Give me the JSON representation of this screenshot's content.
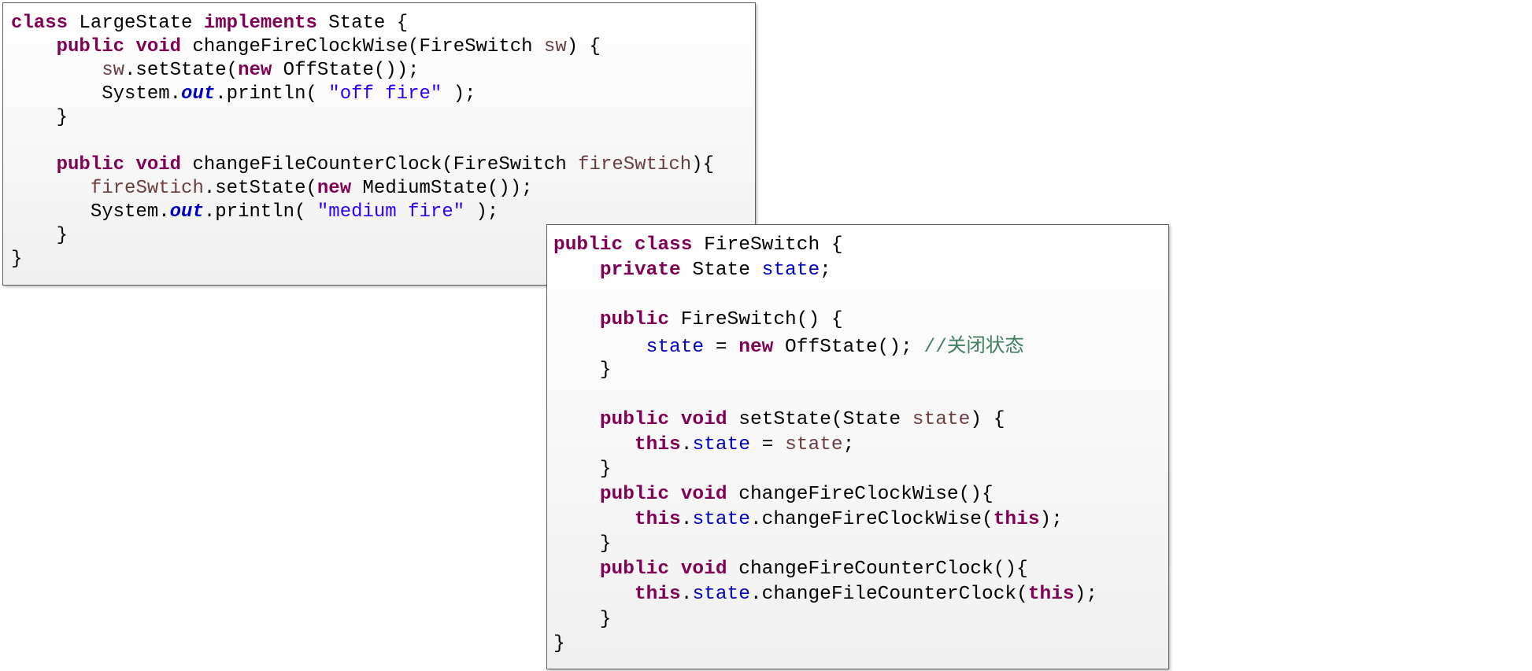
{
  "colors": {
    "keyword": "#7f0055",
    "plain": "#000000",
    "parameter": "#6a3e3e",
    "field": "#0000c0",
    "string": "#2a00ff",
    "comment": "#3f7f5f",
    "border": "#5f5f5f"
  },
  "snippets": [
    {
      "id": "large-state",
      "lines": [
        [
          [
            "kw",
            "class"
          ],
          [
            "plain",
            " LargeState "
          ],
          [
            "kw",
            "implements"
          ],
          [
            "plain",
            " State {"
          ]
        ],
        [
          [
            "plain",
            "    "
          ],
          [
            "kw",
            "public"
          ],
          [
            "plain",
            " "
          ],
          [
            "kw",
            "void"
          ],
          [
            "plain",
            " changeFireClockWise(FireSwitch "
          ],
          [
            "param",
            "sw"
          ],
          [
            "plain",
            ") {"
          ]
        ],
        [
          [
            "plain",
            "        "
          ],
          [
            "param",
            "sw"
          ],
          [
            "plain",
            ".setState("
          ],
          [
            "kw",
            "new"
          ],
          [
            "plain",
            " OffState());"
          ]
        ],
        [
          [
            "plain",
            "        System."
          ],
          [
            "static",
            "out"
          ],
          [
            "plain",
            ".println( "
          ],
          [
            "str",
            "\"off fire\""
          ],
          [
            "plain",
            " );"
          ]
        ],
        [
          [
            "plain",
            "    }"
          ]
        ],
        [
          [
            "plain",
            ""
          ]
        ],
        [
          [
            "plain",
            "    "
          ],
          [
            "kw",
            "public"
          ],
          [
            "plain",
            " "
          ],
          [
            "kw",
            "void"
          ],
          [
            "plain",
            " changeFileCounterClock(FireSwitch "
          ],
          [
            "param",
            "fireSwtich"
          ],
          [
            "plain",
            "){"
          ]
        ],
        [
          [
            "plain",
            "       "
          ],
          [
            "param",
            "fireSwtich"
          ],
          [
            "plain",
            ".setState("
          ],
          [
            "kw",
            "new"
          ],
          [
            "plain",
            " MediumState());"
          ]
        ],
        [
          [
            "plain",
            "       System."
          ],
          [
            "static",
            "out"
          ],
          [
            "plain",
            ".println( "
          ],
          [
            "str",
            "\"medium fire\""
          ],
          [
            "plain",
            " );"
          ]
        ],
        [
          [
            "plain",
            "    }"
          ]
        ],
        [
          [
            "plain",
            "}"
          ]
        ]
      ]
    },
    {
      "id": "fire-switch",
      "lines": [
        [
          [
            "kw",
            "public"
          ],
          [
            "plain",
            " "
          ],
          [
            "kw",
            "class"
          ],
          [
            "plain",
            " FireSwitch {"
          ]
        ],
        [
          [
            "plain",
            "    "
          ],
          [
            "kw",
            "private"
          ],
          [
            "plain",
            " State "
          ],
          [
            "field",
            "state"
          ],
          [
            "plain",
            ";"
          ]
        ],
        [
          [
            "plain",
            ""
          ]
        ],
        [
          [
            "plain",
            "    "
          ],
          [
            "kw",
            "public"
          ],
          [
            "plain",
            " FireSwitch() {"
          ]
        ],
        [
          [
            "plain",
            "        "
          ],
          [
            "field",
            "state"
          ],
          [
            "plain",
            " = "
          ],
          [
            "kw",
            "new"
          ],
          [
            "plain",
            " OffState(); "
          ],
          [
            "comment",
            "//"
          ],
          [
            "comment-cjk",
            "关闭状态"
          ]
        ],
        [
          [
            "plain",
            "    }"
          ]
        ],
        [
          [
            "plain",
            ""
          ]
        ],
        [
          [
            "plain",
            "    "
          ],
          [
            "kw",
            "public"
          ],
          [
            "plain",
            " "
          ],
          [
            "kw",
            "void"
          ],
          [
            "plain",
            " setState(State "
          ],
          [
            "param",
            "state"
          ],
          [
            "plain",
            ") {"
          ]
        ],
        [
          [
            "plain",
            "       "
          ],
          [
            "kw",
            "this"
          ],
          [
            "plain",
            "."
          ],
          [
            "field",
            "state"
          ],
          [
            "plain",
            " = "
          ],
          [
            "param",
            "state"
          ],
          [
            "plain",
            ";"
          ]
        ],
        [
          [
            "plain",
            "    }"
          ]
        ],
        [
          [
            "plain",
            "    "
          ],
          [
            "kw",
            "public"
          ],
          [
            "plain",
            " "
          ],
          [
            "kw",
            "void"
          ],
          [
            "plain",
            " changeFireClockWise(){"
          ]
        ],
        [
          [
            "plain",
            "       "
          ],
          [
            "kw",
            "this"
          ],
          [
            "plain",
            "."
          ],
          [
            "field",
            "state"
          ],
          [
            "plain",
            ".changeFireClockWise("
          ],
          [
            "kw",
            "this"
          ],
          [
            "plain",
            ");"
          ]
        ],
        [
          [
            "plain",
            "    }"
          ]
        ],
        [
          [
            "plain",
            "    "
          ],
          [
            "kw",
            "public"
          ],
          [
            "plain",
            " "
          ],
          [
            "kw",
            "void"
          ],
          [
            "plain",
            " changeFireCounterClock(){"
          ]
        ],
        [
          [
            "plain",
            "       "
          ],
          [
            "kw",
            "this"
          ],
          [
            "plain",
            "."
          ],
          [
            "field",
            "state"
          ],
          [
            "plain",
            ".changeFileCounterClock("
          ],
          [
            "kw",
            "this"
          ],
          [
            "plain",
            ");"
          ]
        ],
        [
          [
            "plain",
            "    }"
          ]
        ],
        [
          [
            "plain",
            "}"
          ]
        ]
      ]
    }
  ]
}
